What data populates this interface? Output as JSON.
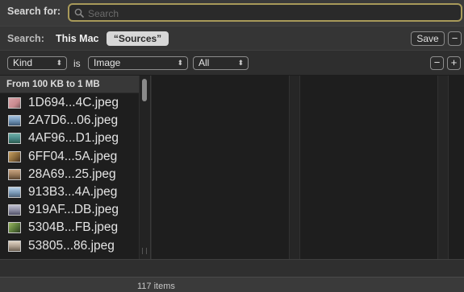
{
  "search": {
    "label": "Search for:",
    "placeholder": "Search",
    "value": ""
  },
  "scope": {
    "label": "Search:",
    "this_mac": "This Mac",
    "sources": "“Sources”",
    "save": "Save",
    "remove": "−"
  },
  "criteria": {
    "attribute": "Kind",
    "operator": "is",
    "value": "Image",
    "subvalue": "All",
    "remove": "−",
    "add": "+"
  },
  "group_header": "From 100 KB to 1 MB",
  "files": [
    {
      "name": "1D694...4C.jpeg",
      "thumb_color": "#c98a8f",
      "thumb_icon": "photo-thumbnail-icon"
    },
    {
      "name": "2A7D6...06.jpeg",
      "thumb_color": "#6b8fb3",
      "thumb_icon": "photo-thumbnail-icon"
    },
    {
      "name": "4AF96...D1.jpeg",
      "thumb_color": "#4a8a8a",
      "thumb_icon": "photo-thumbnail-icon"
    },
    {
      "name": "6FF04...5A.jpeg",
      "thumb_color": "#8a6a3a",
      "thumb_icon": "photo-thumbnail-icon"
    },
    {
      "name": "28A69...25.jpeg",
      "thumb_color": "#9a7a5a",
      "thumb_icon": "photo-thumbnail-icon"
    },
    {
      "name": "913B3...4A.jpeg",
      "thumb_color": "#7a9ab8",
      "thumb_icon": "photo-thumbnail-icon"
    },
    {
      "name": "919AF...DB.jpeg",
      "thumb_color": "#8a8aa0",
      "thumb_icon": "photo-thumbnail-icon"
    },
    {
      "name": "5304B...FB.jpeg",
      "thumb_color": "#5a7a3a",
      "thumb_icon": "photo-thumbnail-icon"
    },
    {
      "name": "53805...86.jpeg",
      "thumb_color": "#b0a090",
      "thumb_icon": "photo-thumbnail-icon"
    }
  ],
  "status": {
    "items": "117 items"
  },
  "colors": {
    "search_focus": "#a89a5a",
    "background": "#1e1e1e",
    "toolbar": "#3a3a3a"
  }
}
